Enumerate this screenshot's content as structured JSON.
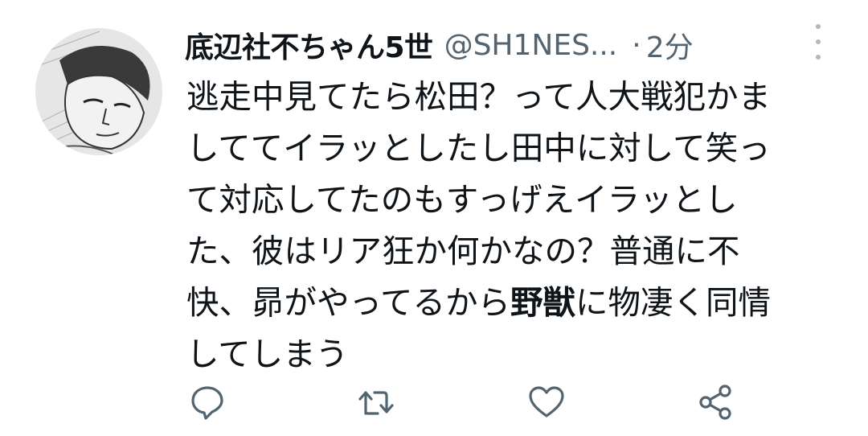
{
  "tweet": {
    "display_name": "底辺社不ちゃん5世",
    "handle": "@SH1NES...",
    "separator": "·",
    "time": "2分",
    "body_lines": [
      [
        "逃走中見てたら松田？って人大戦犯かま"
      ],
      [
        "しててイラッとしたし田中に対して笑っ"
      ],
      [
        "て対応してたのもすっげえイラッとし"
      ],
      [
        "た、彼はリア狂か何かなの？普通に不"
      ],
      [
        "快、昴がやってるから",
        "野獣",
        "に物凄く同情"
      ],
      [
        "してしまう"
      ]
    ]
  },
  "icons": {
    "more": "more-vertical-icon",
    "reply": "reply-icon",
    "retweet": "retweet-icon",
    "like": "heart-icon",
    "share": "share-icon"
  },
  "colors": {
    "text": "#0f1419",
    "secondary": "#536471",
    "icon": "#536471"
  }
}
